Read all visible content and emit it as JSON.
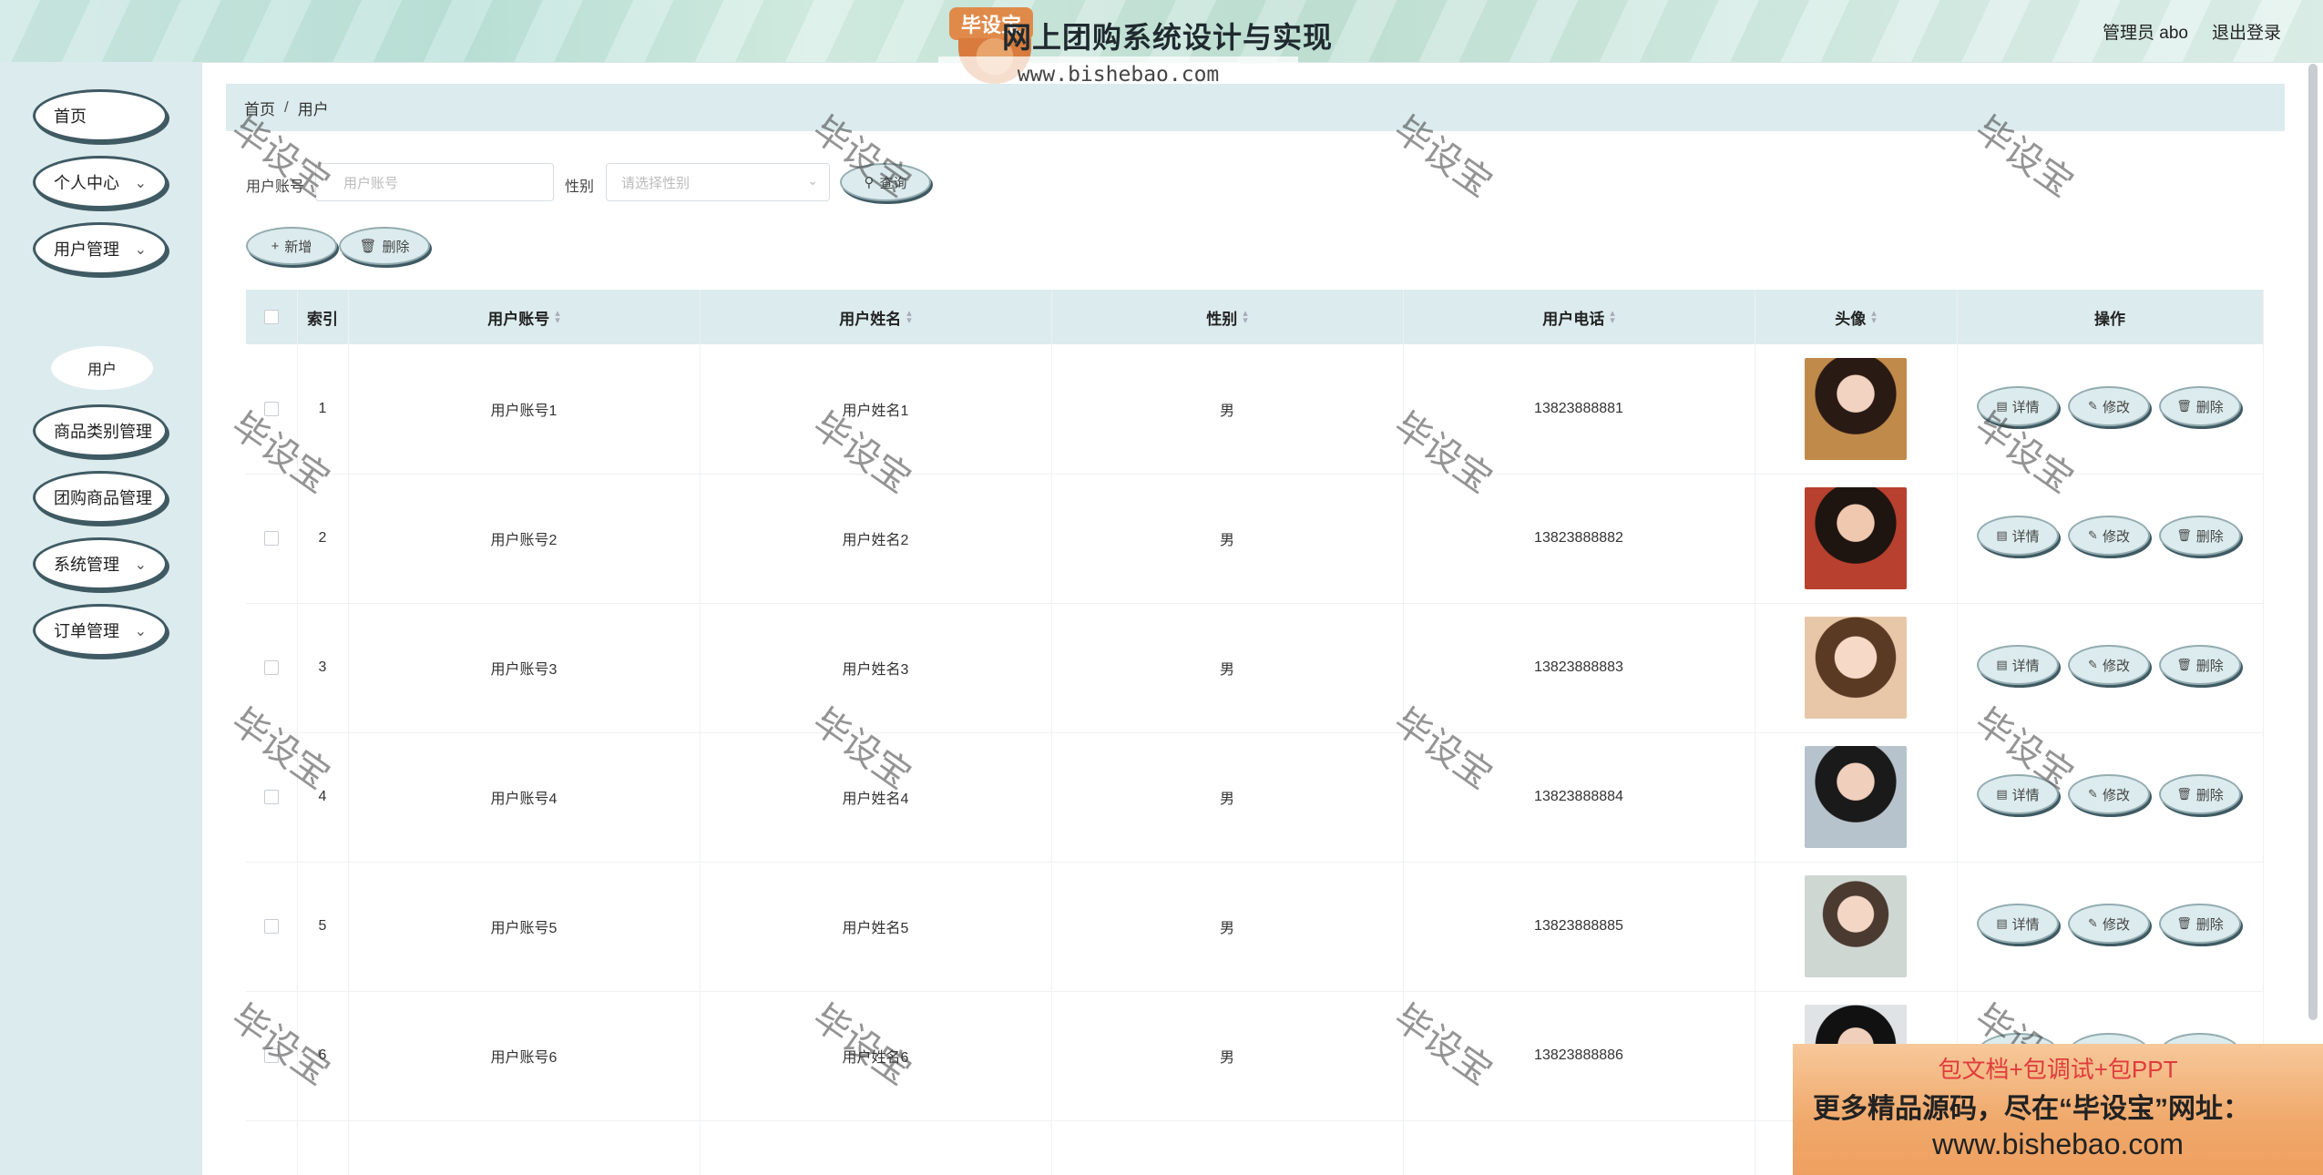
{
  "header": {
    "logo_badge": "毕设宝",
    "title": "网上团购系统设计与实现",
    "watermark_url": "www.bishebao.com",
    "admin_label": "管理员 abo",
    "logout_label": "退出登录"
  },
  "sidebar": {
    "items": [
      {
        "label": "首页",
        "has_arrow": false
      },
      {
        "label": "个人中心",
        "has_arrow": true
      },
      {
        "label": "用户管理",
        "has_arrow": true
      },
      {
        "label": "商品类别管理",
        "has_arrow": false
      },
      {
        "label": "团购商品管理",
        "has_arrow": false
      },
      {
        "label": "系统管理",
        "has_arrow": true
      },
      {
        "label": "订单管理",
        "has_arrow": true
      }
    ],
    "subitem": "用户"
  },
  "breadcrumb": {
    "home": "首页",
    "current": "用户"
  },
  "search": {
    "account_label": "用户账号",
    "account_placeholder": "用户账号",
    "gender_label": "性别",
    "gender_placeholder": "请选择性别",
    "query_button": "查询"
  },
  "toolbar": {
    "add_label": "新增",
    "delete_label": "删除"
  },
  "table": {
    "headers": [
      "索引",
      "用户账号",
      "用户姓名",
      "性别",
      "用户电话",
      "头像",
      "操作"
    ],
    "rows": [
      {
        "index": "1",
        "account": "用户账号1",
        "name": "用户姓名1",
        "gender": "男",
        "phone": "13823888881"
      },
      {
        "index": "2",
        "account": "用户账号2",
        "name": "用户姓名2",
        "gender": "男",
        "phone": "13823888882"
      },
      {
        "index": "3",
        "account": "用户账号3",
        "name": "用户姓名3",
        "gender": "男",
        "phone": "13823888883"
      },
      {
        "index": "4",
        "account": "用户账号4",
        "name": "用户姓名4",
        "gender": "男",
        "phone": "13823888884"
      },
      {
        "index": "5",
        "account": "用户账号5",
        "name": "用户姓名5",
        "gender": "男",
        "phone": "13823888885"
      },
      {
        "index": "6",
        "account": "用户账号6",
        "name": "用户姓名6",
        "gender": "男",
        "phone": "13823888886"
      }
    ],
    "actions": {
      "detail": "详情",
      "edit": "修改",
      "delete": "删除"
    }
  },
  "watermark_text": "毕设宝",
  "ad": {
    "line1": "包文档+包调试+包PPT",
    "line2": "更多精品源码，尽在“毕设宝”网址：",
    "line3": "www.bishebao.com"
  },
  "colors": {
    "accent": "#dcebed",
    "border_dark": "#3f5a63",
    "ad_bg": "#f0a86a"
  }
}
